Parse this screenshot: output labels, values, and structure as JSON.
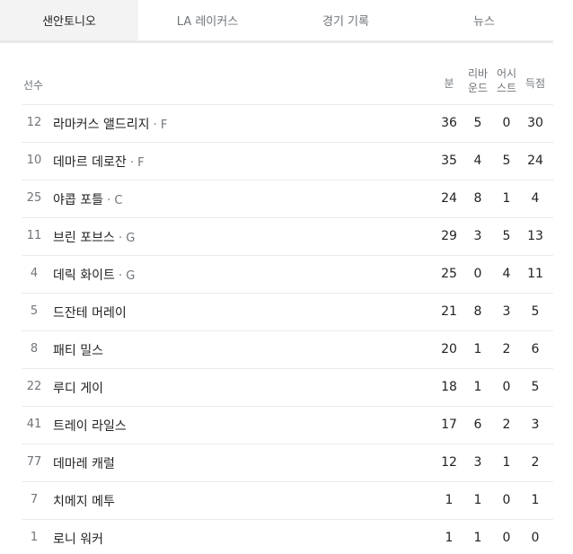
{
  "tabs": [
    {
      "label": "샌안토니오",
      "active": true
    },
    {
      "label": "LA 레이커스",
      "active": false
    },
    {
      "label": "경기 기록",
      "active": false
    },
    {
      "label": "뉴스",
      "active": false
    }
  ],
  "columns": {
    "player": "선수",
    "minutes": "분",
    "rebounds_line1": "리바",
    "rebounds_line2": "운드",
    "assists_line1": "어시",
    "assists_line2": "스트",
    "points": "득점"
  },
  "players": [
    {
      "number": "12",
      "name": "라마커스 앨드리지",
      "pos": " · F",
      "min": "36",
      "reb": "5",
      "ast": "0",
      "pts": "30"
    },
    {
      "number": "10",
      "name": "데마르 데로잔",
      "pos": " · F",
      "min": "35",
      "reb": "4",
      "ast": "5",
      "pts": "24"
    },
    {
      "number": "25",
      "name": "야콥 포틀",
      "pos": " · C",
      "min": "24",
      "reb": "8",
      "ast": "1",
      "pts": "4"
    },
    {
      "number": "11",
      "name": "브린 포브스",
      "pos": " · G",
      "min": "29",
      "reb": "3",
      "ast": "5",
      "pts": "13"
    },
    {
      "number": "4",
      "name": "데릭 화이트",
      "pos": " · G",
      "min": "25",
      "reb": "0",
      "ast": "4",
      "pts": "11"
    },
    {
      "number": "5",
      "name": "드잔테 머레이",
      "pos": "",
      "min": "21",
      "reb": "8",
      "ast": "3",
      "pts": "5"
    },
    {
      "number": "8",
      "name": "패티 밀스",
      "pos": "",
      "min": "20",
      "reb": "1",
      "ast": "2",
      "pts": "6"
    },
    {
      "number": "22",
      "name": "루디 게이",
      "pos": "",
      "min": "18",
      "reb": "1",
      "ast": "0",
      "pts": "5"
    },
    {
      "number": "41",
      "name": "트레이 라일스",
      "pos": "",
      "min": "17",
      "reb": "6",
      "ast": "2",
      "pts": "3"
    },
    {
      "number": "77",
      "name": "데마레 캐럴",
      "pos": "",
      "min": "12",
      "reb": "3",
      "ast": "1",
      "pts": "2"
    },
    {
      "number": "7",
      "name": "치메지 메투",
      "pos": "",
      "min": "1",
      "reb": "1",
      "ast": "0",
      "pts": "1"
    },
    {
      "number": "1",
      "name": "로니 워커",
      "pos": "",
      "min": "1",
      "reb": "1",
      "ast": "0",
      "pts": "0"
    }
  ]
}
